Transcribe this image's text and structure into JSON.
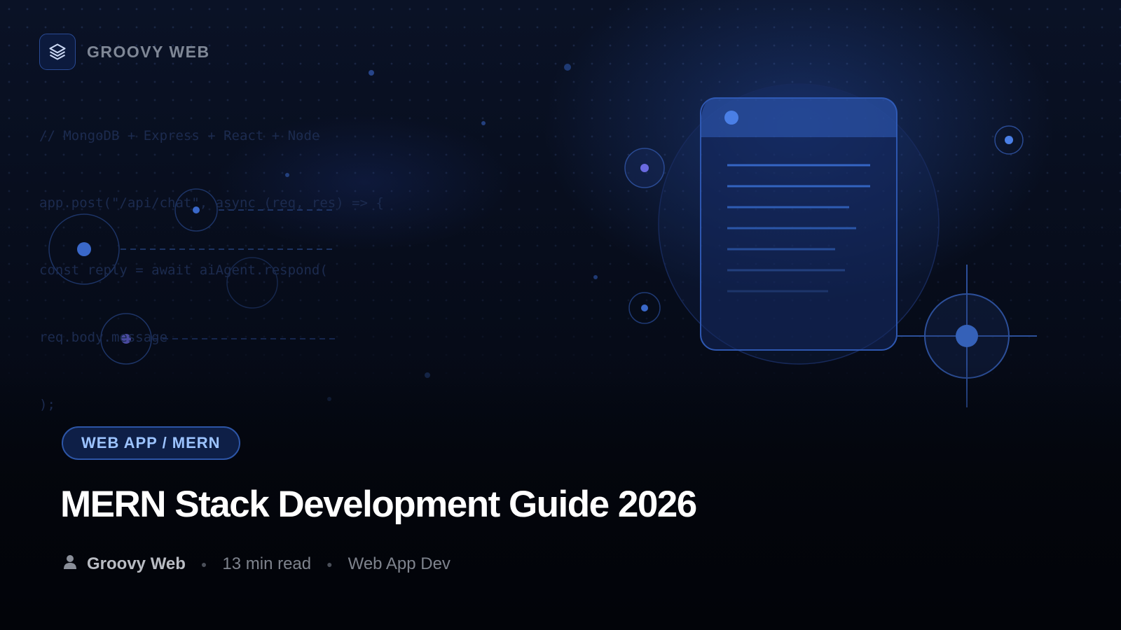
{
  "brand": {
    "name": "GROOVY WEB",
    "logo_icon": "layers-icon"
  },
  "code_snippet": {
    "lines": [
      "// MongoDB + Express + React + Node",
      "app.post(\"/api/chat\", async (req, res) => {",
      "const reply = await aiAgent.respond(",
      "req.body.message",
      ");"
    ]
  },
  "article": {
    "category": "WEB APP / MERN",
    "title": "MERN Stack Development Guide 2026",
    "author": "Groovy Web",
    "author_icon": "user-icon",
    "read_time": "13 min read",
    "section": "Web App Dev"
  },
  "colors": {
    "background": "#05070f",
    "accent": "#3b6fd8",
    "tag_text": "#9cc3ff",
    "title": "#ffffff"
  }
}
